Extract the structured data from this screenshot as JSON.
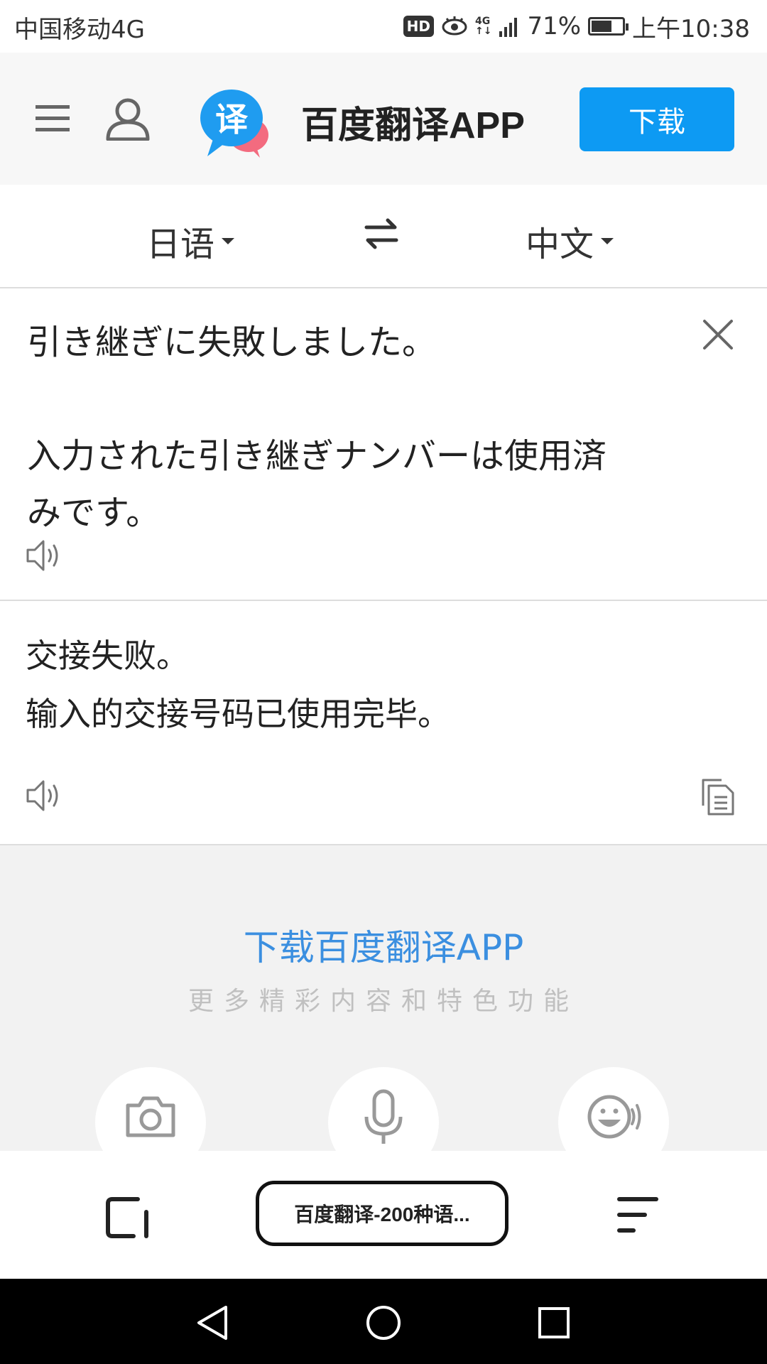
{
  "status_bar": {
    "carrier": "中国移动4G",
    "hd": "HD",
    "network": "4G",
    "battery_percent": "71%",
    "battery_level": 0.71,
    "time": "上午10:38"
  },
  "header": {
    "logo_char": "译",
    "title": "百度翻译APP",
    "download_label": "下载"
  },
  "language_bar": {
    "source_lang": "日语",
    "target_lang": "中文"
  },
  "source": {
    "text": "引き継ぎに失敗しました。\n\n入力された引き継ぎナンバーは使用済\nみです。"
  },
  "result": {
    "text": "交接失败。\n输入的交接号码已使用完毕。"
  },
  "promo": {
    "title": "下载百度翻译APP",
    "subtitle": "更多精彩内容和特色功能"
  },
  "icons": {
    "menu": "menu-icon",
    "user": "user-icon",
    "swap": "swap-icon",
    "clear": "close-icon",
    "speaker": "speaker-icon",
    "copy": "copy-icon",
    "camera": "camera-icon",
    "mic": "microphone-icon",
    "chat": "smile-speaking-icon"
  },
  "colors": {
    "accent": "#0d9af3",
    "promo_link": "#3b8fe0"
  },
  "browser": {
    "tab_title": "百度翻译-200种语..."
  }
}
